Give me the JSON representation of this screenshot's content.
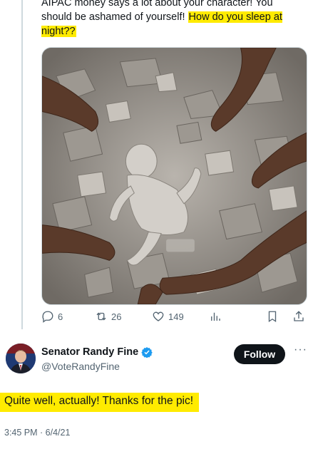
{
  "quoted_tweet": {
    "text_plain": "AIPAC money says a lot about your character! You should be ashamed of yourself! ",
    "text_highlighted": "How do you sleep at night??",
    "media_icon": "rubble-photo-image",
    "actions": {
      "reply_count": "6",
      "retweet_count": "26",
      "like_count": "149"
    }
  },
  "reply_tweet": {
    "author_name": "Senator Randy Fine",
    "author_handle": "@VoteRandyFine",
    "follow_label": "Follow",
    "more_label": "···",
    "text": "Quite well, actually!  Thanks for the pic!",
    "timestamp": "3:45 PM · 6/4/21"
  },
  "colors": {
    "highlight": "#ffeb00",
    "verified": "#1d9bf0",
    "secondary_text": "#536471",
    "follow_bg": "#0f1419"
  }
}
